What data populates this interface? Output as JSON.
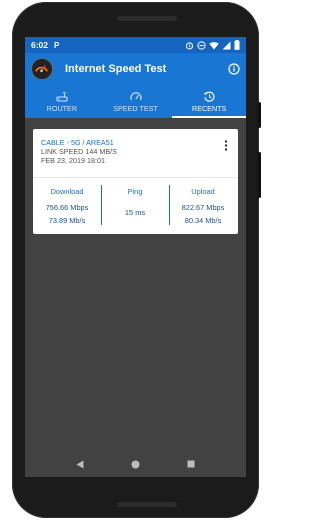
{
  "status": {
    "time": "6:02",
    "p_icon": "P"
  },
  "appbar": {
    "title": "Internet Speed Test",
    "logo_icon": "speedometer-icon",
    "info_icon": "info-icon"
  },
  "tabs": [
    {
      "label": "ROUTER",
      "icon": "router-icon",
      "active": false
    },
    {
      "label": "SPEED TEST",
      "icon": "gauge-icon",
      "active": false
    },
    {
      "label": "RECENTS",
      "icon": "history-icon",
      "active": true
    }
  ],
  "recent": {
    "connection": "CABLE - 5G / AREA51",
    "link_speed": "LINK SPEED 144 MB/S",
    "date": "FEB 23, 2019 18:01",
    "download": {
      "label": "Download",
      "value1": "756.66 Mbps",
      "value2": "73.89 Mb/s"
    },
    "ping": {
      "label": "Ping",
      "value": "15 ms"
    },
    "upload": {
      "label": "Upload",
      "value1": "822.67 Mbps",
      "value2": "80.34 Mb/s"
    }
  },
  "colors": {
    "statusbar": "#1565c0",
    "appbar": "#1976d2",
    "accent": "#1e6fc2",
    "background": "#424242"
  }
}
